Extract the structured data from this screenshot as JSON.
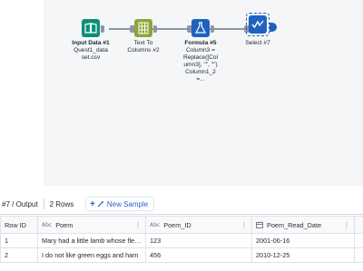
{
  "workflow": {
    "tools": [
      {
        "id": "input",
        "label_bold": "Input Data #1",
        "label_lines": [
          "Quest1_data",
          "set.csv"
        ]
      },
      {
        "id": "text_to_columns",
        "label_bold": "",
        "label_lines": [
          "Text To",
          "Columns #2"
        ]
      },
      {
        "id": "formula",
        "label_bold": "Formula #5",
        "label_lines": [
          "Column3 =",
          "Replace([Col",
          "umn3], \"\", \"\")",
          "Column1_2",
          "=..."
        ]
      },
      {
        "id": "select",
        "label_bold": "",
        "label_lines": [
          "Select #7"
        ]
      }
    ],
    "colors": {
      "input": "#0b8f7a",
      "text_to_columns": "#8aa63a",
      "formula": "#1f63c0",
      "select": "#1f63c0",
      "wire": "#8d96a3"
    }
  },
  "results": {
    "title": "#7 / Output",
    "row_count": "2 Rows",
    "new_sample_label": "New Sample",
    "columns": [
      {
        "label": "Row ID",
        "type_icon": ""
      },
      {
        "label": "Poem",
        "type_icon": "Abc"
      },
      {
        "label": "Poem_ID",
        "type_icon": "Abc"
      },
      {
        "label": "Poem_Read_Date",
        "type_icon": "calendar-icon"
      }
    ],
    "rows": [
      [
        "1",
        "Mary had a little lamb whose fleec...",
        "123",
        "2001-06-16"
      ],
      [
        "2",
        "I do not like green eggs and ham",
        "456",
        "2010-12-25"
      ]
    ]
  }
}
